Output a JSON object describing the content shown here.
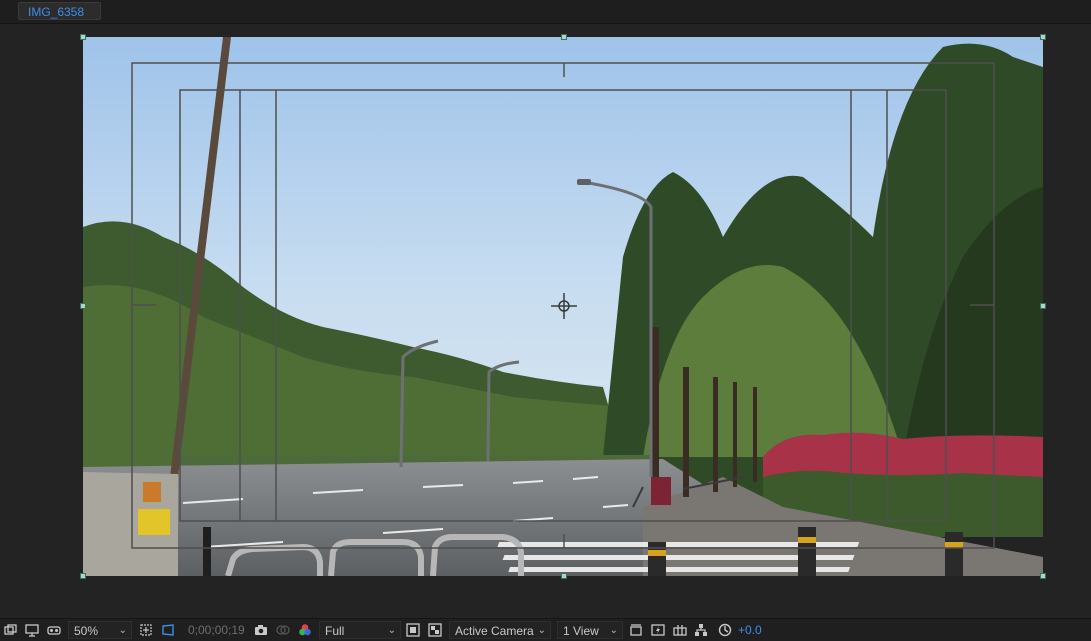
{
  "tab": {
    "label": "IMG_6358"
  },
  "toolbar": {
    "zoom": "50%",
    "timecode": "0;00;00;19",
    "resolution": "Full",
    "camera": "Active Camera",
    "views": "1 View",
    "exposure": "+0.0"
  },
  "icons": {
    "chevron": "⌄"
  }
}
